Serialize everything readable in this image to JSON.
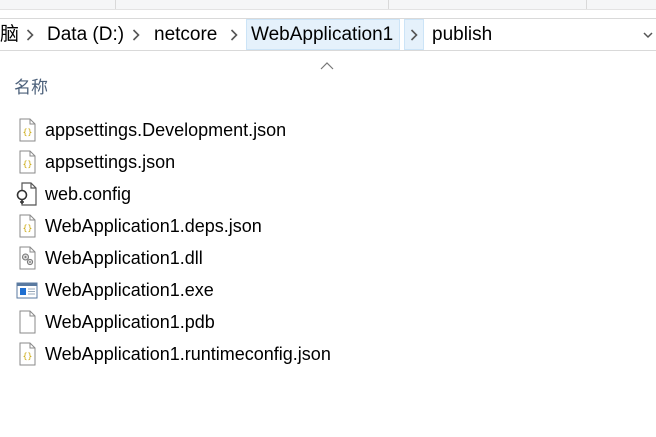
{
  "breadcrumb": {
    "items": [
      {
        "label": "脑"
      },
      {
        "label": "Data (D:)"
      },
      {
        "label": "netcore"
      },
      {
        "label": "WebApplication1"
      },
      {
        "label": "publish"
      }
    ],
    "active_index": 3
  },
  "column_header": {
    "name_label": "名称"
  },
  "files": [
    {
      "name": "appsettings.Development.json",
      "icon": "json-file-icon"
    },
    {
      "name": "appsettings.json",
      "icon": "json-file-icon"
    },
    {
      "name": "web.config",
      "icon": "config-file-icon"
    },
    {
      "name": "WebApplication1.deps.json",
      "icon": "json-file-icon"
    },
    {
      "name": "WebApplication1.dll",
      "icon": "dll-file-icon"
    },
    {
      "name": "WebApplication1.exe",
      "icon": "exe-file-icon"
    },
    {
      "name": "WebApplication1.pdb",
      "icon": "blank-file-icon"
    },
    {
      "name": "WebApplication1.runtimeconfig.json",
      "icon": "json-file-icon"
    }
  ],
  "colors": {
    "active_crumb_bg": "#e5f1fb",
    "header_text": "#4c607a",
    "json_brace": "#c8a400",
    "exe_blue": "#1f6fd1"
  }
}
